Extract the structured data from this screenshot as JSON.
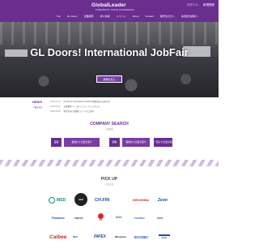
{
  "header": {
    "logo": "GlobalLeader",
    "logo_sub": "POWERED BY FORUM ENGINEERING",
    "links": [
      "ログイン",
      "新規登録"
    ],
    "nav": [
      "Top",
      "GL Doors",
      "企業検索",
      "求人情報",
      "イベント",
      "About",
      "Contact",
      "留学生の方へ",
      "採用担当者様へ"
    ]
  },
  "hero": {
    "title": "GL Doors! International JobFair",
    "button": "詳細を見る"
  },
  "news": {
    "label": "NEWS",
    "more": "一覧を見る",
    "items": [
      {
        "date": "2019.06.10",
        "text": "GL Doors! International JobFair 開催決定のお知らせ"
      },
      {
        "date": "2019.05.22",
        "text": "企業検索ページをリニューアルしました"
      },
      {
        "date": "2019.05.08",
        "text": "留学生向け就職セミナーのご案内"
      }
    ]
  },
  "company_search": {
    "title": "COMPANY SEARCH",
    "subtitle": "企業検索",
    "buttons": [
      "業種",
      "業種から企業を探す",
      "職種",
      "職種から企業を探す",
      "一覧から企業を探す"
    ]
  },
  "pickup": {
    "title": "PICK UP",
    "subtitle": "注目企業",
    "logos": [
      "MSD",
      "GEN",
      "CH.FRI",
      "HIROSHIMA",
      "Zeon",
      "Panasonic",
      "TOKYO",
      "JAL",
      "NOK",
      "FUJITSU",
      "KDDI",
      "Calbee",
      "NEC",
      "INPEX",
      "Mitsubishi",
      "ECONIC",
      "KAO"
    ]
  },
  "colors": {
    "brand": "#6a2e8f",
    "accent": "#7d3fa8"
  }
}
